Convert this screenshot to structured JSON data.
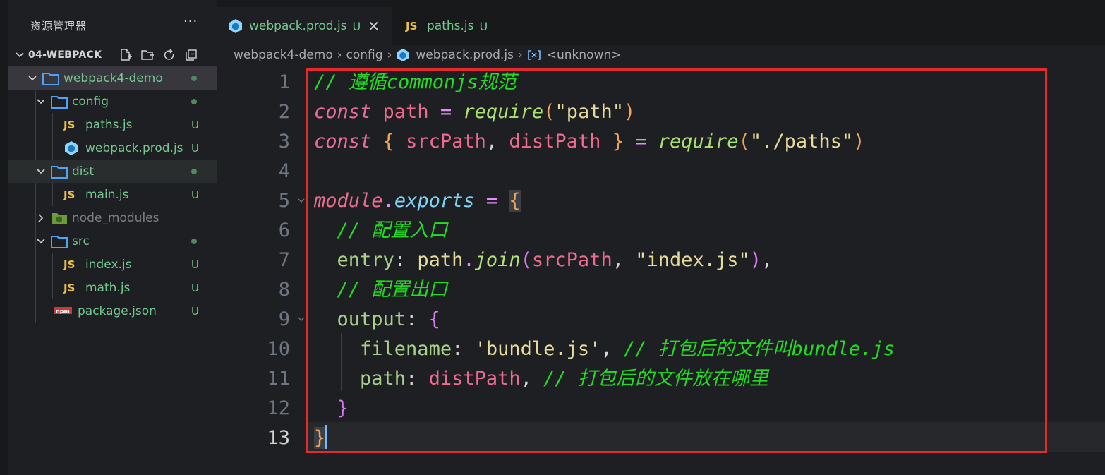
{
  "sidebar": {
    "title": "资源管理器",
    "more": "···",
    "root_label": "04-WEBPACK",
    "tree": [
      {
        "label": "webpack4-demo",
        "type": "folder",
        "depth": 1,
        "badge": "dot",
        "open": true
      },
      {
        "label": "config",
        "type": "folder",
        "depth": 2,
        "badge": "dot",
        "open": true
      },
      {
        "label": "paths.js",
        "type": "js",
        "depth": 3,
        "badge": "U"
      },
      {
        "label": "webpack.prod.js",
        "type": "webpack",
        "depth": 3,
        "badge": "U"
      },
      {
        "label": "dist",
        "type": "folder",
        "depth": 2,
        "badge": "dot",
        "open": true
      },
      {
        "label": "main.js",
        "type": "js",
        "depth": 3,
        "badge": "U"
      },
      {
        "label": "node_modules",
        "type": "node",
        "depth": 2,
        "badge": "",
        "open": false
      },
      {
        "label": "src",
        "type": "folder",
        "depth": 2,
        "badge": "dot",
        "open": true
      },
      {
        "label": "index.js",
        "type": "js",
        "depth": 3,
        "badge": "U"
      },
      {
        "label": "math.js",
        "type": "js",
        "depth": 3,
        "badge": "U"
      },
      {
        "label": "package.json",
        "type": "npm",
        "depth": 2,
        "badge": "U"
      }
    ]
  },
  "tabs": [
    {
      "name": "webpack.prod.js",
      "status": "U",
      "close": "✕",
      "icon": "js"
    },
    {
      "name": "paths.js",
      "status": "U",
      "icon": "JS"
    }
  ],
  "breadcrumb": {
    "items": [
      "webpack4-demo",
      "config",
      "webpack.prod.js",
      "<unknown>"
    ],
    "sep": "›"
  },
  "editor": {
    "line_numbers": [
      "1",
      "2",
      "3",
      "4",
      "5",
      "6",
      "7",
      "8",
      "9",
      "10",
      "11",
      "12",
      "13"
    ],
    "current_line": "13",
    "lines": [
      [
        [
          "cmt",
          "// 遵循commonjs规范"
        ]
      ],
      [
        [
          "kw",
          "const"
        ],
        [
          "plain",
          " "
        ],
        [
          "var",
          "path"
        ],
        [
          "plain",
          " "
        ],
        [
          "op",
          "="
        ],
        [
          "plain",
          " "
        ],
        [
          "fn",
          "require"
        ],
        [
          "br1",
          "("
        ],
        [
          "str",
          "\"path\""
        ],
        [
          "br1",
          ")"
        ]
      ],
      [
        [
          "kw",
          "const"
        ],
        [
          "plain",
          " "
        ],
        [
          "br1",
          "{"
        ],
        [
          "plain",
          " "
        ],
        [
          "var",
          "srcPath"
        ],
        [
          "plain",
          ", "
        ],
        [
          "var",
          "distPath"
        ],
        [
          "plain",
          " "
        ],
        [
          "br1",
          "}"
        ],
        [
          "plain",
          " "
        ],
        [
          "op",
          "="
        ],
        [
          "plain",
          " "
        ],
        [
          "fn",
          "require"
        ],
        [
          "br1",
          "("
        ],
        [
          "str",
          "\"./paths\""
        ],
        [
          "br1",
          ")"
        ]
      ],
      [],
      [
        [
          "mod",
          "module"
        ],
        [
          "op",
          "."
        ],
        [
          "exp",
          "exports"
        ],
        [
          "plain",
          " "
        ],
        [
          "op",
          "="
        ],
        [
          "plain",
          " "
        ],
        [
          "br1hl",
          "{"
        ]
      ],
      [
        [
          "plain",
          "  "
        ],
        [
          "cmt",
          "// 配置入口"
        ]
      ],
      [
        [
          "plain",
          "  "
        ],
        [
          "prop",
          "entry"
        ],
        [
          "plain",
          ": "
        ],
        [
          "str",
          "path"
        ],
        [
          "op",
          "."
        ],
        [
          "meth",
          "join"
        ],
        [
          "br2",
          "("
        ],
        [
          "var",
          "srcPath"
        ],
        [
          "plain",
          ", "
        ],
        [
          "str",
          "\"index.js\""
        ],
        [
          "br2",
          ")"
        ],
        [
          "plain",
          ","
        ]
      ],
      [
        [
          "plain",
          "  "
        ],
        [
          "cmt",
          "// 配置出口"
        ]
      ],
      [
        [
          "plain",
          "  "
        ],
        [
          "prop",
          "output"
        ],
        [
          "plain",
          ": "
        ],
        [
          "br2",
          "{"
        ]
      ],
      [
        [
          "plain",
          "    "
        ],
        [
          "prop",
          "filename"
        ],
        [
          "plain",
          ": "
        ],
        [
          "str",
          "'bundle.js'"
        ],
        [
          "plain",
          ", "
        ],
        [
          "cmt",
          "// 打包后的文件叫bundle.js"
        ]
      ],
      [
        [
          "plain",
          "    "
        ],
        [
          "prop",
          "path"
        ],
        [
          "plain",
          ": "
        ],
        [
          "var",
          "distPath"
        ],
        [
          "plain",
          ", "
        ],
        [
          "cmt",
          "// 打包后的文件放在哪里"
        ]
      ],
      [
        [
          "plain",
          "  "
        ],
        [
          "br2",
          "}"
        ]
      ],
      [
        [
          "br1hl",
          "}"
        ]
      ]
    ]
  },
  "colors": {
    "accent": "#73c991",
    "highlight_box": "#e32b2b",
    "cursor": "#79b8ff"
  }
}
